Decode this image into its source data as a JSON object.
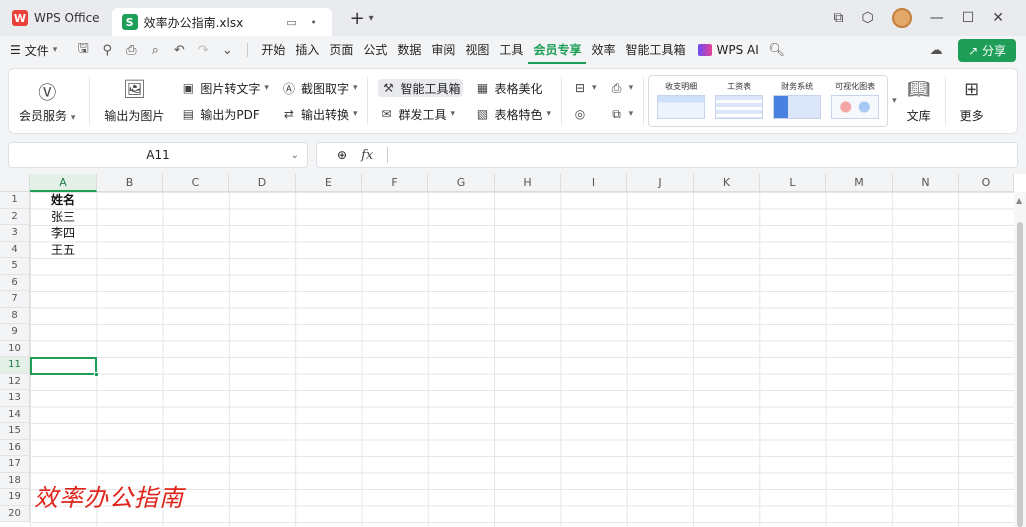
{
  "titlebar": {
    "app_name": "WPS Office",
    "app_logo": "W",
    "doc_logo": "S",
    "doc_title": "效率办公指南.xlsx",
    "plus": "+"
  },
  "menubar": {
    "file": "文件",
    "items": [
      "开始",
      "插入",
      "页面",
      "公式",
      "数据",
      "审阅",
      "视图",
      "工具",
      "会员专享",
      "效率",
      "智能工具箱"
    ],
    "active_index": 8,
    "wps_ai": "WPS AI",
    "share": "分享"
  },
  "ribbon": {
    "member_service": "会员服务",
    "export_image": "输出为图片",
    "image_to_text": "图片转文字",
    "export_pdf": "输出为PDF",
    "screenshot_text": "截图取字",
    "output_convert": "输出转换",
    "smart_toolbox": "智能工具箱",
    "group_send": "群发工具",
    "table_beautify": "表格美化",
    "table_feature": "表格特色",
    "templates": [
      "收支明细",
      "工资表",
      "财务系统",
      "可视化图表"
    ],
    "library": "文库",
    "more": "更多"
  },
  "formula_bar": {
    "name_box": "A11",
    "fx": "fx",
    "formula": ""
  },
  "sheet": {
    "columns": [
      "A",
      "B",
      "C",
      "D",
      "E",
      "F",
      "G",
      "H",
      "I",
      "J",
      "K",
      "L",
      "M",
      "N",
      "O"
    ],
    "rows": [
      "1",
      "2",
      "3",
      "4",
      "5",
      "6",
      "7",
      "8",
      "9",
      "10",
      "11",
      "12",
      "13",
      "14",
      "15",
      "16",
      "17",
      "18",
      "19",
      "20"
    ],
    "selected_row": "11",
    "cells": {
      "A1": "姓名",
      "A2": "张三",
      "A3": "李四",
      "A4": "王五"
    }
  },
  "watermark": "效率办公指南"
}
